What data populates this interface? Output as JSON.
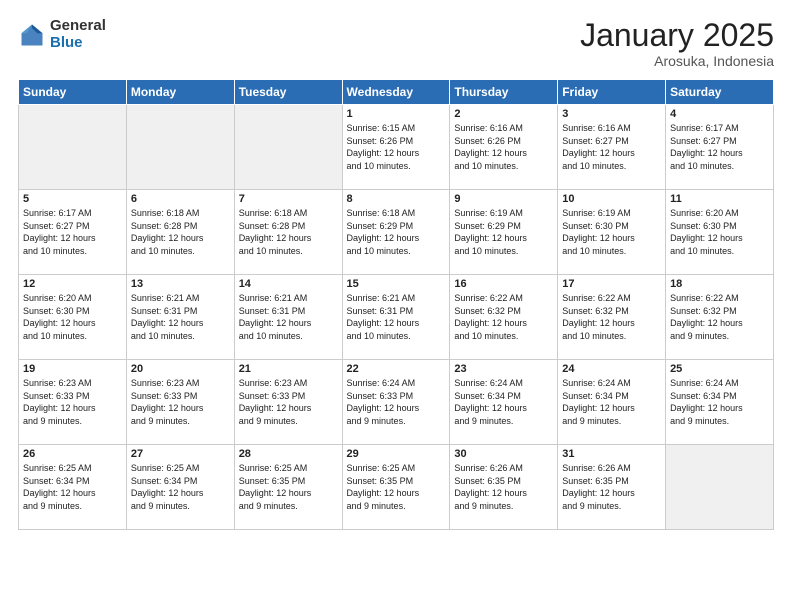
{
  "logo": {
    "general": "General",
    "blue": "Blue"
  },
  "header": {
    "month": "January 2025",
    "location": "Arosuka, Indonesia"
  },
  "days_of_week": [
    "Sunday",
    "Monday",
    "Tuesday",
    "Wednesday",
    "Thursday",
    "Friday",
    "Saturday"
  ],
  "weeks": [
    [
      {
        "day": "",
        "info": ""
      },
      {
        "day": "",
        "info": ""
      },
      {
        "day": "",
        "info": ""
      },
      {
        "day": "1",
        "info": "Sunrise: 6:15 AM\nSunset: 6:26 PM\nDaylight: 12 hours\nand 10 minutes."
      },
      {
        "day": "2",
        "info": "Sunrise: 6:16 AM\nSunset: 6:26 PM\nDaylight: 12 hours\nand 10 minutes."
      },
      {
        "day": "3",
        "info": "Sunrise: 6:16 AM\nSunset: 6:27 PM\nDaylight: 12 hours\nand 10 minutes."
      },
      {
        "day": "4",
        "info": "Sunrise: 6:17 AM\nSunset: 6:27 PM\nDaylight: 12 hours\nand 10 minutes."
      }
    ],
    [
      {
        "day": "5",
        "info": "Sunrise: 6:17 AM\nSunset: 6:27 PM\nDaylight: 12 hours\nand 10 minutes."
      },
      {
        "day": "6",
        "info": "Sunrise: 6:18 AM\nSunset: 6:28 PM\nDaylight: 12 hours\nand 10 minutes."
      },
      {
        "day": "7",
        "info": "Sunrise: 6:18 AM\nSunset: 6:28 PM\nDaylight: 12 hours\nand 10 minutes."
      },
      {
        "day": "8",
        "info": "Sunrise: 6:18 AM\nSunset: 6:29 PM\nDaylight: 12 hours\nand 10 minutes."
      },
      {
        "day": "9",
        "info": "Sunrise: 6:19 AM\nSunset: 6:29 PM\nDaylight: 12 hours\nand 10 minutes."
      },
      {
        "day": "10",
        "info": "Sunrise: 6:19 AM\nSunset: 6:30 PM\nDaylight: 12 hours\nand 10 minutes."
      },
      {
        "day": "11",
        "info": "Sunrise: 6:20 AM\nSunset: 6:30 PM\nDaylight: 12 hours\nand 10 minutes."
      }
    ],
    [
      {
        "day": "12",
        "info": "Sunrise: 6:20 AM\nSunset: 6:30 PM\nDaylight: 12 hours\nand 10 minutes."
      },
      {
        "day": "13",
        "info": "Sunrise: 6:21 AM\nSunset: 6:31 PM\nDaylight: 12 hours\nand 10 minutes."
      },
      {
        "day": "14",
        "info": "Sunrise: 6:21 AM\nSunset: 6:31 PM\nDaylight: 12 hours\nand 10 minutes."
      },
      {
        "day": "15",
        "info": "Sunrise: 6:21 AM\nSunset: 6:31 PM\nDaylight: 12 hours\nand 10 minutes."
      },
      {
        "day": "16",
        "info": "Sunrise: 6:22 AM\nSunset: 6:32 PM\nDaylight: 12 hours\nand 10 minutes."
      },
      {
        "day": "17",
        "info": "Sunrise: 6:22 AM\nSunset: 6:32 PM\nDaylight: 12 hours\nand 10 minutes."
      },
      {
        "day": "18",
        "info": "Sunrise: 6:22 AM\nSunset: 6:32 PM\nDaylight: 12 hours\nand 9 minutes."
      }
    ],
    [
      {
        "day": "19",
        "info": "Sunrise: 6:23 AM\nSunset: 6:33 PM\nDaylight: 12 hours\nand 9 minutes."
      },
      {
        "day": "20",
        "info": "Sunrise: 6:23 AM\nSunset: 6:33 PM\nDaylight: 12 hours\nand 9 minutes."
      },
      {
        "day": "21",
        "info": "Sunrise: 6:23 AM\nSunset: 6:33 PM\nDaylight: 12 hours\nand 9 minutes."
      },
      {
        "day": "22",
        "info": "Sunrise: 6:24 AM\nSunset: 6:33 PM\nDaylight: 12 hours\nand 9 minutes."
      },
      {
        "day": "23",
        "info": "Sunrise: 6:24 AM\nSunset: 6:34 PM\nDaylight: 12 hours\nand 9 minutes."
      },
      {
        "day": "24",
        "info": "Sunrise: 6:24 AM\nSunset: 6:34 PM\nDaylight: 12 hours\nand 9 minutes."
      },
      {
        "day": "25",
        "info": "Sunrise: 6:24 AM\nSunset: 6:34 PM\nDaylight: 12 hours\nand 9 minutes."
      }
    ],
    [
      {
        "day": "26",
        "info": "Sunrise: 6:25 AM\nSunset: 6:34 PM\nDaylight: 12 hours\nand 9 minutes."
      },
      {
        "day": "27",
        "info": "Sunrise: 6:25 AM\nSunset: 6:34 PM\nDaylight: 12 hours\nand 9 minutes."
      },
      {
        "day": "28",
        "info": "Sunrise: 6:25 AM\nSunset: 6:35 PM\nDaylight: 12 hours\nand 9 minutes."
      },
      {
        "day": "29",
        "info": "Sunrise: 6:25 AM\nSunset: 6:35 PM\nDaylight: 12 hours\nand 9 minutes."
      },
      {
        "day": "30",
        "info": "Sunrise: 6:26 AM\nSunset: 6:35 PM\nDaylight: 12 hours\nand 9 minutes."
      },
      {
        "day": "31",
        "info": "Sunrise: 6:26 AM\nSunset: 6:35 PM\nDaylight: 12 hours\nand 9 minutes."
      },
      {
        "day": "",
        "info": ""
      }
    ]
  ]
}
